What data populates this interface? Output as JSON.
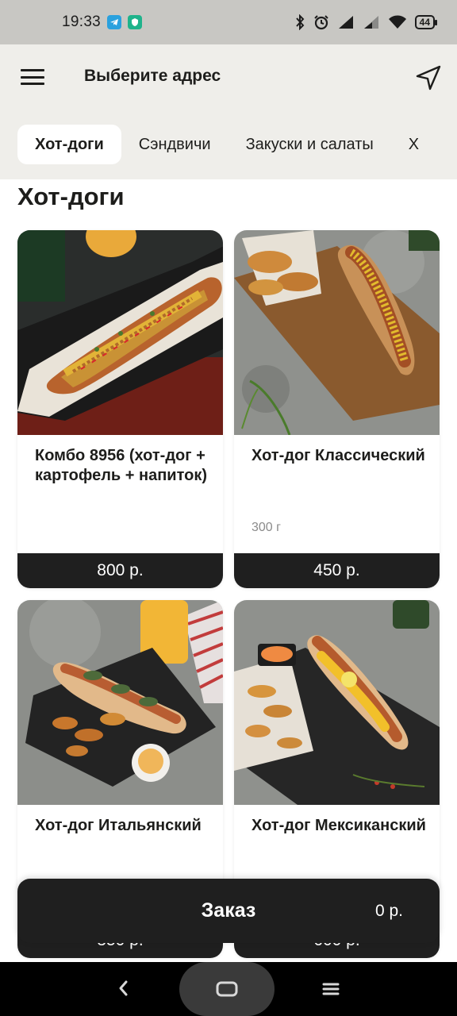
{
  "status_bar": {
    "time": "19:33",
    "battery": "44",
    "icons": [
      "telegram-icon",
      "shield-icon",
      "bluetooth-icon",
      "alarm-icon",
      "signal-icon",
      "signal-icon",
      "wifi-icon",
      "battery-icon"
    ]
  },
  "header": {
    "address_label": "Выберите адрес",
    "menu_icon": "hamburger-menu-icon",
    "location_icon": "navigation-arrow-icon"
  },
  "tabs": [
    {
      "label": "Хот-доги",
      "active": true
    },
    {
      "label": "Сэндвичи",
      "active": false
    },
    {
      "label": "Закуски и салаты",
      "active": false
    },
    {
      "label": "Х",
      "active": false
    }
  ],
  "section_title": "Хот-доги",
  "products": [
    {
      "name": "Комбо 8956 (хот-дог + картофель + напиток)",
      "weight": "",
      "price": "800 р."
    },
    {
      "name": "Хот-дог Классический",
      "weight": "300 г",
      "price": "450 р."
    },
    {
      "name": "Хот-дог Итальянский",
      "weight": "",
      "price": "350 р."
    },
    {
      "name": "Хот-дог Мексиканский",
      "weight": "",
      "price": "600 р."
    }
  ],
  "order_bar": {
    "label": "Заказ",
    "total": "0 р."
  },
  "nav": {
    "back_icon": "back-chevron-icon",
    "home_icon": "home-icon",
    "recents_icon": "recents-menu-icon"
  },
  "colors": {
    "header_bg": "#efeeea",
    "status_bg": "#c8c7c3",
    "dark": "#1f1f1f",
    "muted": "#8b8b8b"
  }
}
